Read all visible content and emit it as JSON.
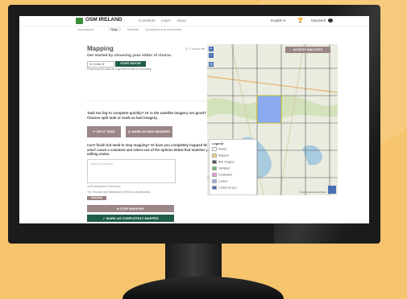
{
  "app": {
    "logo_text": "OSM IRELAND",
    "nav": [
      "Contribute",
      "Learn",
      "About"
    ],
    "language": "English",
    "username": "MaxDedt",
    "subtabs": [
      "Instructions",
      "Map",
      "Validate",
      "Questions and comments"
    ],
    "active_subtab": "Map"
  },
  "panel": {
    "title": "Mapping",
    "time_left": "2 hours left",
    "subtitle": "Get started by choosing your editor of choice.",
    "editor_value": "iD Editor",
    "start_editor": "START EDITOR",
    "download_text": "Download this task as a gpx file to see its boundary.",
    "split_question": "Task too big to complete quickly? Or is the satellite imagery not good? Choose split task or mark as bad imagery.",
    "split_button": "SPLIT TASK",
    "bad_imagery_button": "MARK AS BAD IMAGERY",
    "finish_question": "Can't finish but need to stop mapping? Or have you completely mapped the area? Leave a comment and select one of the options below that matches your editing status.",
    "comment_placeholder": "Leave a comment",
    "chars_remaining": "1000 characters remaining",
    "tip": "Tip: You can use Markdown (HTML is not allowed).",
    "preview": "PREVIEW",
    "stop_button": "STOP MAPPING",
    "complete_button": "MARK AS COMPLETELY MAPPED"
  },
  "map": {
    "activity_button": "ACTIVITY AND STATS",
    "legend_title": "Legend",
    "legend": [
      {
        "label": "Ready",
        "color": "#ffffff"
      },
      {
        "label": "Mapped",
        "color": "#f2d27a"
      },
      {
        "label": "Bad imagery",
        "color": "#555555"
      },
      {
        "label": "Validated",
        "color": "#6cb86c"
      },
      {
        "label": "Invalidated",
        "color": "#e89ad3"
      },
      {
        "label": "Locked",
        "color": "#9ab0e0"
      },
      {
        "label": "Locked by you",
        "color": "#4a6fb5"
      }
    ],
    "attribution": "© OpenStreetMap contributors"
  },
  "colors": {
    "primary": "#1f5c4a",
    "secondary": "#9a8686",
    "selected_task": "#8aaaf0"
  }
}
